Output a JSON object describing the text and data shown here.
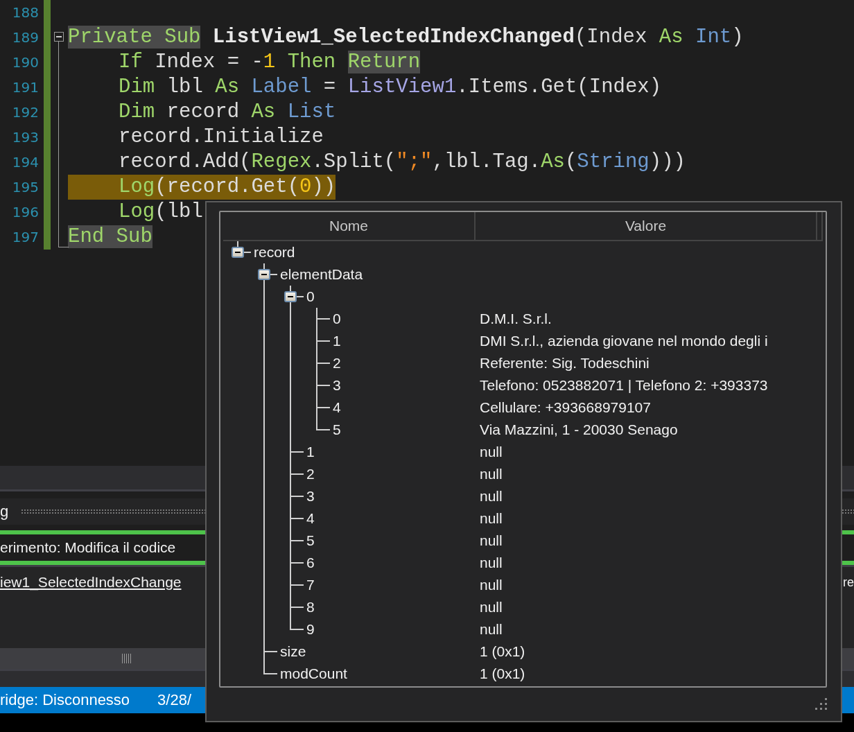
{
  "editor": {
    "lines": [
      {
        "number": "188",
        "kind": "line"
      },
      {
        "number": "189",
        "indented": false,
        "current": false,
        "kind": "open",
        "tokens": [
          {
            "text": "Private Sub",
            "kind": "kw",
            "hl": true
          },
          {
            "text": " ListView1_SelectedIndexChanged",
            "kind": "name",
            "hl": false
          },
          {
            "text": "(Index ",
            "kind": "plain",
            "hl": false
          },
          {
            "text": "As",
            "kind": "kw",
            "hl": false
          },
          {
            "text": " Int",
            "kind": "type",
            "hl": false
          },
          {
            "text": ")",
            "kind": "plain",
            "hl": false
          }
        ]
      },
      {
        "number": "190",
        "indented": true,
        "current": false,
        "kind": "body",
        "tokens": [
          {
            "text": "If",
            "kind": "kw",
            "hl": false
          },
          {
            "text": " Index = -",
            "kind": "plain",
            "hl": false
          },
          {
            "text": "1",
            "kind": "num",
            "hl": false
          },
          {
            "text": " Then ",
            "kind": "kw",
            "hl": false
          },
          {
            "text": "Return",
            "kind": "kw",
            "hl": true
          }
        ]
      },
      {
        "number": "191",
        "indented": true,
        "current": false,
        "kind": "body",
        "tokens": [
          {
            "text": "Dim",
            "kind": "kw",
            "hl": false
          },
          {
            "text": " lbl ",
            "kind": "plain",
            "hl": false
          },
          {
            "text": "As",
            "kind": "kw",
            "hl": false
          },
          {
            "text": " Label",
            "kind": "type",
            "hl": false
          },
          {
            "text": " = ",
            "kind": "plain",
            "hl": false
          },
          {
            "text": "ListView1",
            "kind": "cls",
            "hl": false
          },
          {
            "text": ".Items.Get(Index)",
            "kind": "plain",
            "hl": false
          }
        ]
      },
      {
        "number": "192",
        "indented": true,
        "current": false,
        "kind": "body",
        "tokens": [
          {
            "text": "Dim",
            "kind": "kw",
            "hl": false
          },
          {
            "text": " record ",
            "kind": "plain",
            "hl": false
          },
          {
            "text": "As",
            "kind": "kw",
            "hl": false
          },
          {
            "text": " List",
            "kind": "type",
            "hl": false
          }
        ]
      },
      {
        "number": "193",
        "indented": true,
        "current": false,
        "kind": "body",
        "tokens": [
          {
            "text": "record.Initialize",
            "kind": "plain",
            "hl": false
          }
        ]
      },
      {
        "number": "194",
        "indented": true,
        "current": false,
        "kind": "body",
        "tokens": [
          {
            "text": "record.Add(",
            "kind": "plain",
            "hl": false
          },
          {
            "text": "Regex",
            "kind": "kw",
            "hl": false
          },
          {
            "text": ".Split(",
            "kind": "plain",
            "hl": false
          },
          {
            "text": "\";\"",
            "kind": "str",
            "hl": false
          },
          {
            "text": ",lbl.Tag.",
            "kind": "plain",
            "hl": false
          },
          {
            "text": "As",
            "kind": "kw",
            "hl": false
          },
          {
            "text": "(",
            "kind": "plain",
            "hl": false
          },
          {
            "text": "String",
            "kind": "type",
            "hl": false
          },
          {
            "text": ")))",
            "kind": "plain",
            "hl": false
          }
        ]
      },
      {
        "number": "195",
        "indented": true,
        "current": true,
        "kind": "body",
        "tokens": [
          {
            "text": "Log",
            "kind": "kw",
            "hl": false
          },
          {
            "text": "(record.Get(",
            "kind": "plain",
            "hl": false
          },
          {
            "text": "0",
            "kind": "num",
            "hl": false
          },
          {
            "text": "))",
            "kind": "plain",
            "hl": false
          }
        ]
      },
      {
        "number": "196",
        "indented": true,
        "current": false,
        "kind": "body",
        "tokens": [
          {
            "text": "Log",
            "kind": "kw",
            "hl": false
          },
          {
            "text": "(lbl",
            "kind": "plain",
            "hl": false
          }
        ]
      },
      {
        "number": "197",
        "indented": false,
        "current": false,
        "kind": "end",
        "tokens": [
          {
            "text": "End Sub",
            "kind": "kw",
            "hl": true
          }
        ]
      }
    ]
  },
  "panel": {
    "tab": "g",
    "hint": "erimento: Modifica il codice",
    "link": "iew1_SelectedIndexChange",
    "link_right": "re"
  },
  "status_bar": {
    "bridge": "ridge: Disconnesso",
    "date": "3/28/"
  },
  "watch": {
    "columns": [
      "Nome",
      "Valore"
    ],
    "tree": [
      {
        "name": "record",
        "expanded": true,
        "children": [
          {
            "name": "elementData",
            "expanded": true,
            "children": [
              {
                "name": "0",
                "expanded": true,
                "children": [
                  {
                    "name": "0",
                    "value": "D.M.I. S.r.l."
                  },
                  {
                    "name": "1",
                    "value": "DMI S.r.l., azienda giovane nel mondo degli i"
                  },
                  {
                    "name": "2",
                    "value": "Referente: Sig. Todeschini"
                  },
                  {
                    "name": "3",
                    "value": "Telefono: 0523882071 | Telefono 2: +393373"
                  },
                  {
                    "name": "4",
                    "value": "Cellulare: +393668979107"
                  },
                  {
                    "name": "5",
                    "value": "Via Mazzini, 1 - 20030 Senago"
                  }
                ]
              },
              {
                "name": "1",
                "value": "null"
              },
              {
                "name": "2",
                "value": "null"
              },
              {
                "name": "3",
                "value": "null"
              },
              {
                "name": "4",
                "value": "null"
              },
              {
                "name": "5",
                "value": "null"
              },
              {
                "name": "6",
                "value": "null"
              },
              {
                "name": "7",
                "value": "null"
              },
              {
                "name": "8",
                "value": "null"
              },
              {
                "name": "9",
                "value": "null"
              }
            ]
          },
          {
            "name": "size",
            "value": "1 (0x1)"
          },
          {
            "name": "modCount",
            "value": "1 (0x1)"
          }
        ]
      }
    ]
  }
}
